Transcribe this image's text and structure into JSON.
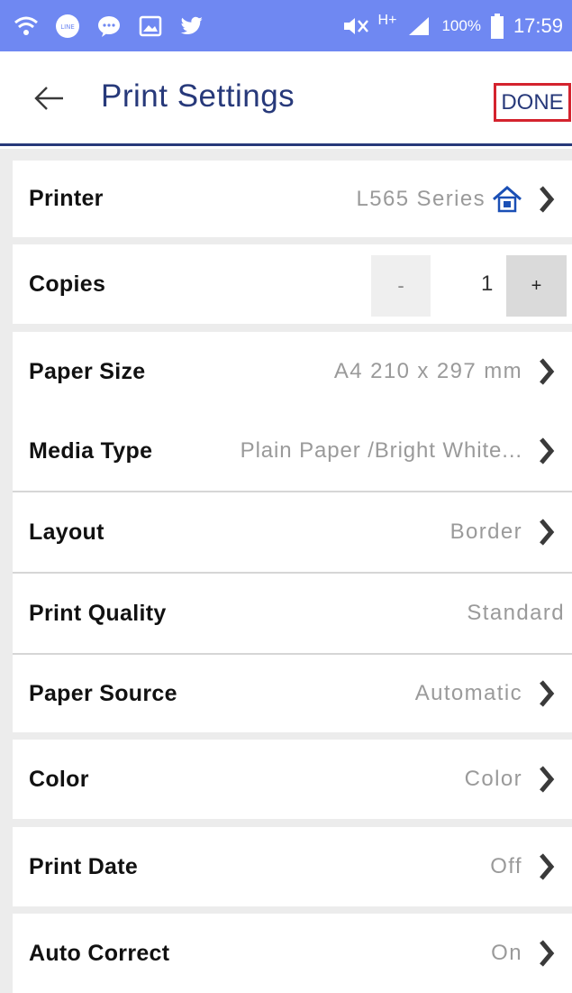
{
  "status_bar": {
    "icons": [
      "wifi-icon",
      "line-app-icon",
      "gallery-icon",
      "twitter-icon",
      "mute-vibrate-icon",
      "hplus-network-icon",
      "signal-icon",
      "battery-icon"
    ],
    "network_type": "H+",
    "battery": "100%",
    "time": "17:59",
    "background_color": "#6f88f2"
  },
  "app_bar": {
    "title": "Print Settings",
    "done_label": "DONE",
    "title_color": "#27397a",
    "done_border_color": "#d4232e"
  },
  "settings": {
    "printer": {
      "label": "Printer",
      "value": "L565 Series"
    },
    "copies": {
      "label": "Copies",
      "minus": "-",
      "value": "1",
      "plus": "+"
    },
    "paper_size": {
      "label": "Paper Size",
      "value": "A4 210 x 297 mm"
    },
    "media_type": {
      "label": "Media Type",
      "value": "Plain Paper /Bright White..."
    },
    "layout": {
      "label": "Layout",
      "value": "Border"
    },
    "print_quality": {
      "label": "Print Quality",
      "value": "Standard"
    },
    "paper_source": {
      "label": "Paper Source",
      "value": "Automatic"
    },
    "color": {
      "label": "Color",
      "value": "Color"
    },
    "print_date": {
      "label": "Print Date",
      "value": "Off"
    },
    "auto_correct": {
      "label": "Auto Correct",
      "value": "On"
    }
  }
}
